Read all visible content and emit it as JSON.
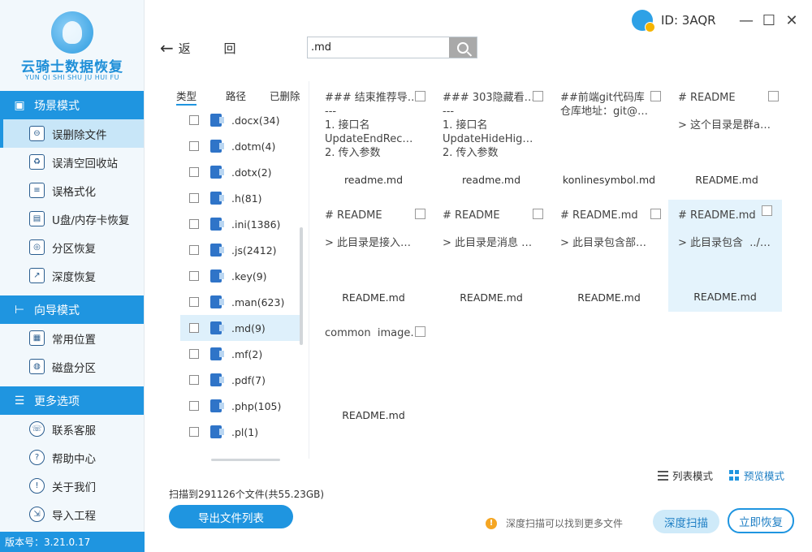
{
  "app": {
    "title": "云骑士数据恢复",
    "subtitle": "YUN QI SHI SHU JU HUI FU",
    "version": "版本号：3.21.0.17",
    "user_id": "ID: 3AQR"
  },
  "sidebar": {
    "sections": [
      {
        "title": "场景模式",
        "icon": "scene-icon",
        "items": [
          {
            "label": "误删除文件",
            "icon": "deleted-file-icon",
            "active": true
          },
          {
            "label": "误清空回收站",
            "icon": "recycle-bin-icon"
          },
          {
            "label": "误格式化",
            "icon": "format-icon"
          },
          {
            "label": "U盘/内存卡恢复",
            "icon": "usb-card-icon"
          },
          {
            "label": "分区恢复",
            "icon": "partition-icon"
          },
          {
            "label": "深度恢复",
            "icon": "deep-recovery-icon"
          }
        ]
      },
      {
        "title": "向导模式",
        "icon": "guide-icon",
        "items": [
          {
            "label": "常用位置",
            "icon": "common-location-icon"
          },
          {
            "label": "磁盘分区",
            "icon": "disk-partition-icon"
          }
        ]
      },
      {
        "title": "更多选项",
        "icon": "menu-icon",
        "items": [
          {
            "label": "联系客服",
            "icon": "customer-service-icon"
          },
          {
            "label": "帮助中心",
            "icon": "help-icon"
          },
          {
            "label": "关于我们",
            "icon": "info-icon"
          },
          {
            "label": "导入工程",
            "icon": "import-project-icon"
          }
        ]
      }
    ]
  },
  "toolbar": {
    "back_label": "返 回",
    "search_value": ".md"
  },
  "filter_tabs": [
    "类型",
    "路径",
    "已删除"
  ],
  "file_types": [
    {
      "label": ".docx(34)"
    },
    {
      "label": ".dotm(4)"
    },
    {
      "label": ".dotx(2)"
    },
    {
      "label": ".h(81)"
    },
    {
      "label": ".ini(1386)"
    },
    {
      "label": ".js(2412)"
    },
    {
      "label": ".key(9)"
    },
    {
      "label": ".man(623)"
    },
    {
      "label": ".md(9)",
      "selected": true
    },
    {
      "label": ".mf(2)"
    },
    {
      "label": ".pdf(7)"
    },
    {
      "label": ".php(105)"
    },
    {
      "label": ".pl(1)"
    }
  ],
  "preview_files": [
    {
      "snippet": "### 结束推荐导…\n---\n1. 接口名\nUpdateEndRec…\n2. 传入参数",
      "name": "readme.md"
    },
    {
      "snippet": "### 303隐藏看…\n---\n1. 接口名\nUpdateHideHig…\n2. 传入参数",
      "name": "readme.md"
    },
    {
      "snippet": "##前端git代码库\n仓库地址：git@…",
      "name": "konlinesymbol.md"
    },
    {
      "snippet": "# README\n\n> 这个目录是群a…",
      "name": "README.md"
    },
    {
      "snippet": "# README\n\n> 此目录是接入…",
      "name": "README.md"
    },
    {
      "snippet": "# README\n\n> 此目录是消息 …",
      "name": "README.md"
    },
    {
      "snippet": "# README.md\n\n> 此目录包含部…",
      "name": "README.md"
    },
    {
      "snippet": "# README.md\n\n> 此目录包含  ../…",
      "name": "README.md",
      "highlighted": true
    },
    {
      "snippet": "common  image…",
      "name": "README.md"
    }
  ],
  "view_modes": {
    "list": "列表模式",
    "preview": "预览模式",
    "active": "preview"
  },
  "scan_summary": "扫描到291126个文件(共55.23GB)",
  "buttons": {
    "export": "导出文件列表",
    "deep_scan": "深度扫描",
    "recover": "立即恢复"
  },
  "tip": "深度扫描可以找到更多文件",
  "colors": {
    "accent": "#1f95e0",
    "highlight": "#e4f3fc",
    "warning": "#f5a623"
  }
}
